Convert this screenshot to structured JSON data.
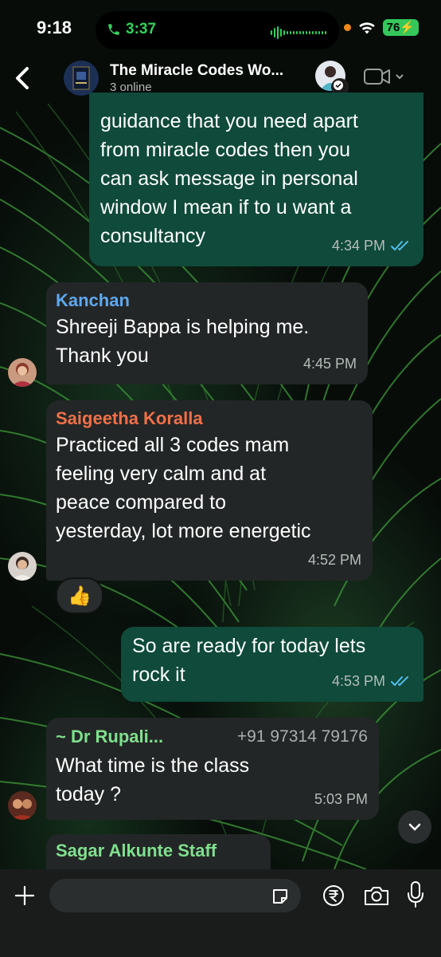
{
  "status_bar": {
    "time": "9:18",
    "call_time": "3:37",
    "battery": "76"
  },
  "header": {
    "title": "The Miracle Codes Wo...",
    "subtitle": "3 online"
  },
  "messages": [
    {
      "direction": "outgoing",
      "text": "guidance that you need apart\nfrom miracle codes then you\ncan ask message in personal\nwindow I mean if to u want a\nconsultancy",
      "time": "4:34 PM",
      "status": "read"
    },
    {
      "direction": "incoming",
      "sender": "Kanchan",
      "sender_color": "#5ea8f0",
      "text": "Shreeji Bappa is helping me.\nThank you",
      "time": "4:45 PM"
    },
    {
      "direction": "incoming",
      "sender": "Saigeetha Koralla",
      "sender_color": "#f0704a",
      "text": "Practiced all 3 codes mam\nfeeling very calm and at\npeace compared to\nyesterday, lot more energetic",
      "time": "4:52 PM",
      "reaction": "👍"
    },
    {
      "direction": "outgoing",
      "text": "So are ready for today lets\nrock it",
      "time": "4:53 PM",
      "status": "read"
    },
    {
      "direction": "incoming",
      "sender": "~ Dr Rupali...",
      "sender_color": "#7fe08e",
      "phone": "+91 97314 79176",
      "text": "What time is the class\ntoday ?",
      "time": "5:03 PM"
    },
    {
      "direction": "incoming",
      "sender": "Sagar Alkunte Staff",
      "sender_color": "#7fe08e"
    }
  ],
  "input": {
    "placeholder": ""
  },
  "colors": {
    "outgoing_bubble": "#0f4a3a",
    "incoming_bubble": "#232626",
    "read_ticks": "#53bdeb",
    "accent_green": "#33d15c"
  }
}
